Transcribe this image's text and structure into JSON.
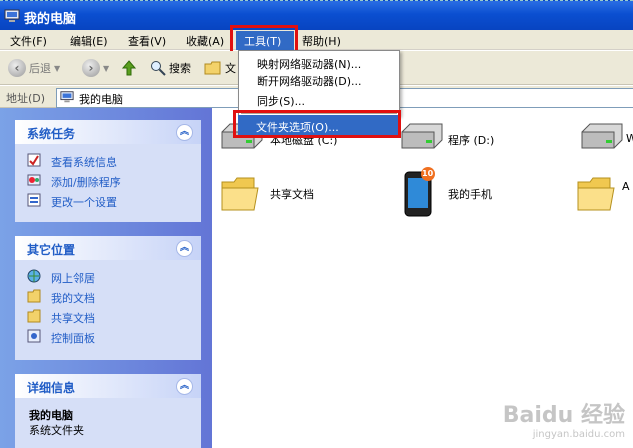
{
  "window": {
    "title": "我的电脑"
  },
  "menubar": {
    "items": [
      "文件(F)",
      "编辑(E)",
      "查看(V)",
      "收藏(A)",
      "工具(T)",
      "帮助(H)"
    ]
  },
  "toolbar": {
    "back": "后退",
    "search": "搜索",
    "folders_partial": "文"
  },
  "address": {
    "label": "地址(D)",
    "value": "我的电脑"
  },
  "tools_menu": {
    "items": [
      "映射网络驱动器(N)...",
      "断开网络驱动器(D)...",
      "同步(S)...",
      "文件夹选项(O)..."
    ],
    "highlighted": "文件夹选项(O)..."
  },
  "left_panels": {
    "system_tasks": {
      "title": "系统任务",
      "items": [
        "查看系统信息",
        "添加/删除程序",
        "更改一个设置"
      ]
    },
    "other_places": {
      "title": "其它位置",
      "items": [
        "网上邻居",
        "我的文档",
        "共享文档",
        "控制面板"
      ]
    },
    "details": {
      "title": "详细信息",
      "name": "我的电脑",
      "desc": "系统文件夹"
    }
  },
  "content": {
    "drive1_label": "本地磁盘 (C:)",
    "drive2_label": "程序 (D:)",
    "drive3_label": "W",
    "shared_docs": "共享文档",
    "my_phone": "我的手机",
    "partial_folder": "A",
    "phone_badge": "10"
  },
  "watermark": {
    "brand": "Baidu 经验",
    "url": "jingyan.baidu.com"
  },
  "colors": {
    "title_blue": "#0b4fd1",
    "menu_highlight": "#316ac5",
    "annotation_red": "#e01010",
    "link_blue": "#215dc6"
  }
}
